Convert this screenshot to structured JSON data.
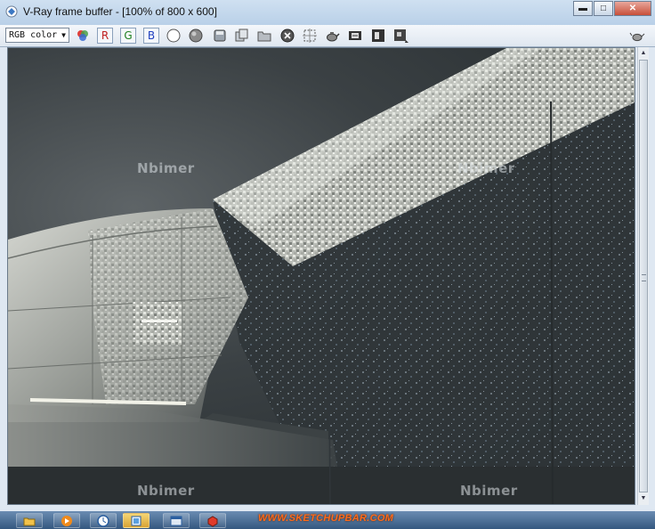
{
  "window": {
    "title": "V-Ray frame buffer - [100% of 800 x 600]",
    "minimize_label": "▬",
    "maximize_label": "□",
    "close_label": "✕"
  },
  "toolbar": {
    "channel_select": "RGB color",
    "red_label": "R",
    "green_label": "G",
    "blue_label": "B",
    "icons": [
      "color-balls-icon",
      "red-channel",
      "green-channel",
      "blue-channel",
      "white-circle-icon",
      "gray-sphere-icon",
      "save-icon",
      "clone-icon",
      "open-folder-icon",
      "clear-icon",
      "region-render-icon",
      "teapot-render-icon",
      "lut-icon",
      "info-icon",
      "vfb-history-icon"
    ]
  },
  "watermarks": [
    "Nbimer",
    "Nbimer",
    "Nbimer",
    "Nbimer"
  ],
  "taskbar": {
    "site_text": "WWW.SKETCHUPBAR.COM",
    "buttons": [
      "file-explorer-icon",
      "media-player-icon",
      "clock-icon",
      "app-icon",
      "window-icon",
      "sketchup-icon"
    ]
  },
  "colors": {
    "titlebar": "#c3d6ec",
    "taskbar": "#34577f",
    "accent_orange": "#ff6a1a"
  }
}
